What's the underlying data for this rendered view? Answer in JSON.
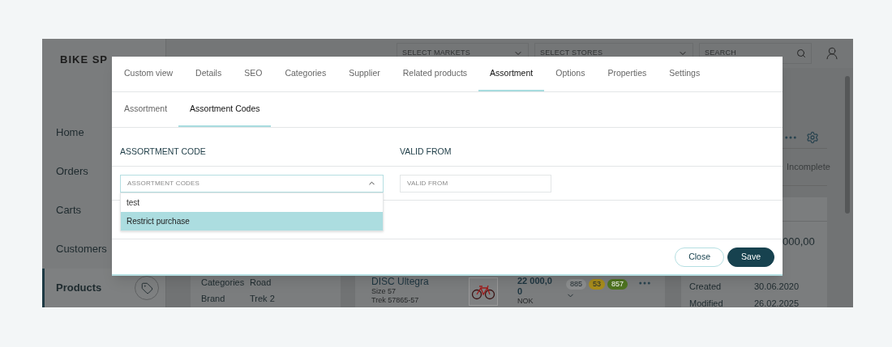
{
  "app": {
    "logo": "BIKE SP",
    "markets": {
      "placeholder": "SELECT MARKETS"
    },
    "stores": {
      "placeholder": "SELECT STORES"
    },
    "search": {
      "placeholder": "SEARCH"
    },
    "nav": [
      {
        "label": "Home",
        "selected": false
      },
      {
        "label": "Orders",
        "selected": false
      },
      {
        "label": "Carts",
        "selected": false
      },
      {
        "label": "Customers",
        "selected": false
      },
      {
        "label": "Products",
        "selected": true
      }
    ],
    "status": "Incomplete",
    "price_partial": "000,00",
    "attributes": [
      {
        "label": "Categories",
        "value": "Road"
      },
      {
        "label": "Brand",
        "value": "Trek 2"
      }
    ],
    "product": {
      "name": "DISC Ultegra",
      "size": "Size 57",
      "sku": "Trek 57865-57",
      "price": "22 000,00",
      "currency": "NOK",
      "stock": [
        {
          "value": "885",
          "color": "#8c8e8f"
        },
        {
          "value": "53",
          "color": "#a88d1c"
        },
        {
          "value": "857",
          "color": "#4e7420"
        }
      ]
    },
    "dates": [
      {
        "label": "Created",
        "value": "30.06.2020"
      },
      {
        "label": "Modified",
        "value": "26.02.2025"
      }
    ]
  },
  "modal": {
    "tabs": [
      {
        "label": "Custom view",
        "selected": false
      },
      {
        "label": "Details",
        "selected": false
      },
      {
        "label": "SEO",
        "selected": false
      },
      {
        "label": "Categories",
        "selected": false
      },
      {
        "label": "Supplier",
        "selected": false
      },
      {
        "label": "Related products",
        "selected": false
      },
      {
        "label": "Assortment",
        "selected": true
      },
      {
        "label": "Options",
        "selected": false
      },
      {
        "label": "Properties",
        "selected": false
      },
      {
        "label": "Settings",
        "selected": false
      }
    ],
    "subtabs": [
      {
        "label": "Assortment",
        "selected": false
      },
      {
        "label": "Assortment Codes",
        "selected": true
      }
    ],
    "columns": [
      "ASSORTMENT CODE",
      "VALID FROM"
    ],
    "code_select": {
      "placeholder": "ASSORTMENT CODES",
      "expanded": true,
      "options": [
        {
          "label": "test",
          "selected": false
        },
        {
          "label": "Restrict purchase",
          "selected": true
        }
      ]
    },
    "valid_from": {
      "placeholder": "VALID FROM"
    },
    "buttons": [
      {
        "label": "Close",
        "kind": "secondary"
      },
      {
        "label": "Save",
        "kind": "primary"
      }
    ]
  }
}
